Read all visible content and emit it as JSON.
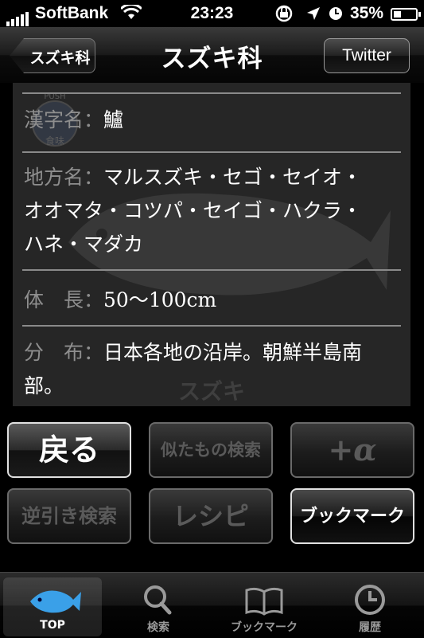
{
  "status_bar": {
    "carrier": "SoftBank",
    "time": "23:23",
    "battery": "35%",
    "battery_level": 0.35
  },
  "nav": {
    "back_label": "スズキ科",
    "title": "スズキ科",
    "twitter_label": "Twitter"
  },
  "panel": {
    "badge_push": "PUSH",
    "badge_taste": "食味",
    "watermark": "スズキ",
    "fields": [
      {
        "label": "漢字名：",
        "value": "鱸"
      },
      {
        "label": "地方名：",
        "value": "マルスズキ・セゴ・セイオ・",
        "value2": "オオマタ・コツパ・セイゴ・ハクラ・",
        "value3": "ハネ・マダカ"
      },
      {
        "label": "体　長：",
        "value": "50〜100cm"
      },
      {
        "label": "分　布：",
        "value": "日本各地の沿岸。朝鮮半島南",
        "value2": "部。"
      }
    ]
  },
  "buttons": {
    "back": "戻る",
    "similar_search": "似たもの検索",
    "plus_alpha": "+α",
    "reverse_search": "逆引き検索",
    "recipe": "レシピ",
    "bookmark": "ブックマーク"
  },
  "tabs": [
    {
      "label": "TOP",
      "icon": "fish-icon",
      "selected": true
    },
    {
      "label": "検索",
      "icon": "search-icon",
      "selected": false
    },
    {
      "label": "ブックマーク",
      "icon": "book-icon",
      "selected": false
    },
    {
      "label": "履歴",
      "icon": "clock-icon",
      "selected": false
    }
  ]
}
